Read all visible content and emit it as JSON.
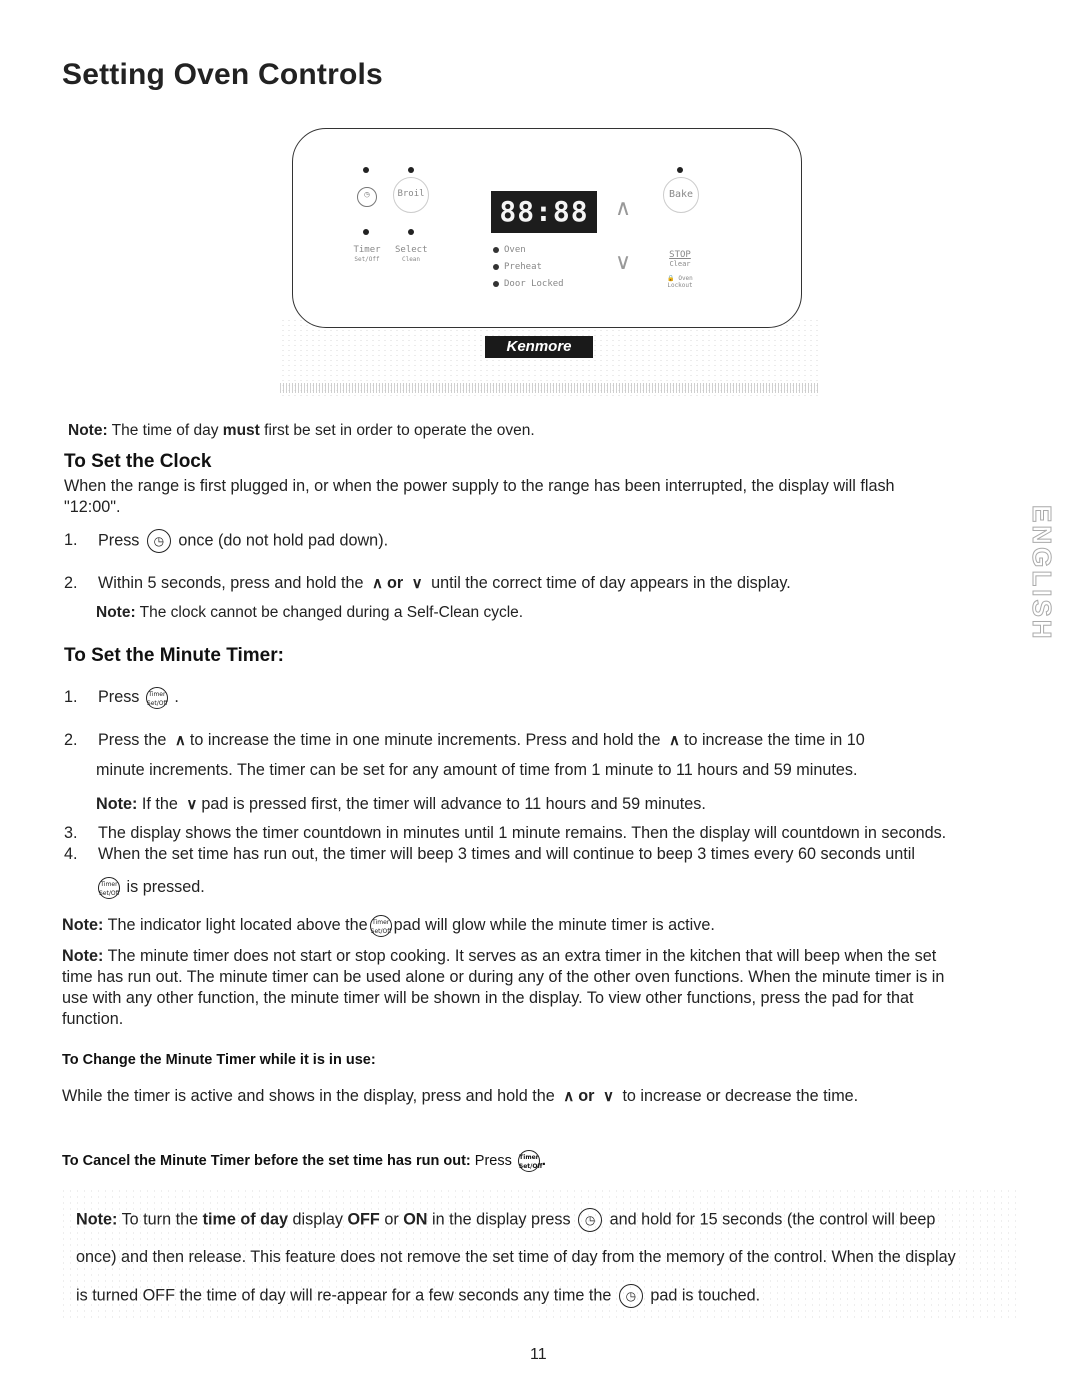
{
  "page": {
    "title": "Setting Oven Controls",
    "side_tab": "ENGLISH",
    "page_number": "11"
  },
  "panel": {
    "display": "88:88",
    "pads": {
      "clock_icon": "clock-icon",
      "broil": "Broil",
      "bake": "Bake",
      "timer": "Timer",
      "timer_sub": "Set/Off",
      "select": "Select",
      "select_sub": "Clean",
      "stop": "STOP",
      "stop_sub": "Clear",
      "oven_lockout": "Oven",
      "oven_lockout_sub": "Lockout"
    },
    "indicators": [
      "Oven",
      "Preheat",
      "Door Locked"
    ],
    "brand": "Kenmore"
  },
  "intro_note": {
    "label": "Note:",
    "before": "The time of day",
    "bold": "must",
    "after": "first be set in order to operate the oven."
  },
  "clock": {
    "heading": "To Set the Clock",
    "intro_1": "When the range is first plugged in, or when the power supply to the range has been interrupted, the display will flash",
    "intro_2": "\"12:00\".",
    "step1_num": "1.",
    "step1_a": "Press",
    "step1_b": "once (do not hold pad down).",
    "step2_num": "2.",
    "step2_a": "Within 5 seconds, press and hold the",
    "step2_or": "or",
    "step2_b": "until the correct time of day appears in the display.",
    "note_label": "Note:",
    "note_text": "The clock cannot be changed during a Self-Clean cycle."
  },
  "timer": {
    "heading": "To Set the Minute Timer:",
    "step1_num": "1.",
    "step1_a": "Press",
    "step2_num": "2.",
    "step2_a": "Press the",
    "step2_b": "to increase the time in one minute increments. Press and hold the",
    "step2_c": "to increase the time in 10",
    "step2_d": "minute increments. The timer can be set for any amount of time from 1 minute to 11 hours and 59 minutes.",
    "note_label": "Note:",
    "note_a": "If the",
    "note_b": "pad is pressed first, the timer will advance to 11 hours and 59 minutes.",
    "step3_num": "3.",
    "step3": "The display shows the timer countdown in minutes until 1 minute remains. Then the display will countdown in seconds.",
    "step4_num": "4.",
    "step4_a": "When the set time has run out, the timer will beep 3 times and will continue to beep 3 times every 60 seconds until",
    "step4_b": "is pressed.",
    "note2_label": "Note:",
    "note2_a": "The indicator light located above the",
    "note2_b": "pad will glow while the minute timer is active.",
    "note3_label": "Note:",
    "note3_1": "The minute timer does not start or stop cooking. It serves as an extra timer in the kitchen that will beep when the set",
    "note3_2": "time has run out. The minute timer can be used alone or during any of the other oven functions. When the minute timer is in",
    "note3_3": "use with any other function, the minute timer will be shown in the display. To view other functions, press the pad for that",
    "note3_4": "function."
  },
  "change": {
    "heading": "To Change the Minute Timer while it is in use:",
    "text_a": "While the timer is active and shows in the display, press and hold the",
    "or": "or",
    "text_b": "to increase or decrease the time."
  },
  "cancel": {
    "heading": "To Cancel the Minute Timer before the set time has run out:",
    "press": "Press"
  },
  "display_note": {
    "label": "Note:",
    "a": "To turn the",
    "b_bold": "time of day",
    "c": "display",
    "off": "OFF",
    "or": "or",
    "on": "ON",
    "d": "in the display press",
    "e": "and hold for 15 seconds (the control will beep",
    "line2": "once) and then release. This feature does not remove the set time of day from the memory of the control. When the display",
    "line3_a": "is turned OFF the time of day will re-appear for a few seconds any time the",
    "line3_b": "pad is touched."
  },
  "icons": {
    "timer_pad_1": "Timer",
    "timer_pad_2": "Set/Off",
    "up": "∧",
    "down": "∨",
    "clock": "◷"
  }
}
